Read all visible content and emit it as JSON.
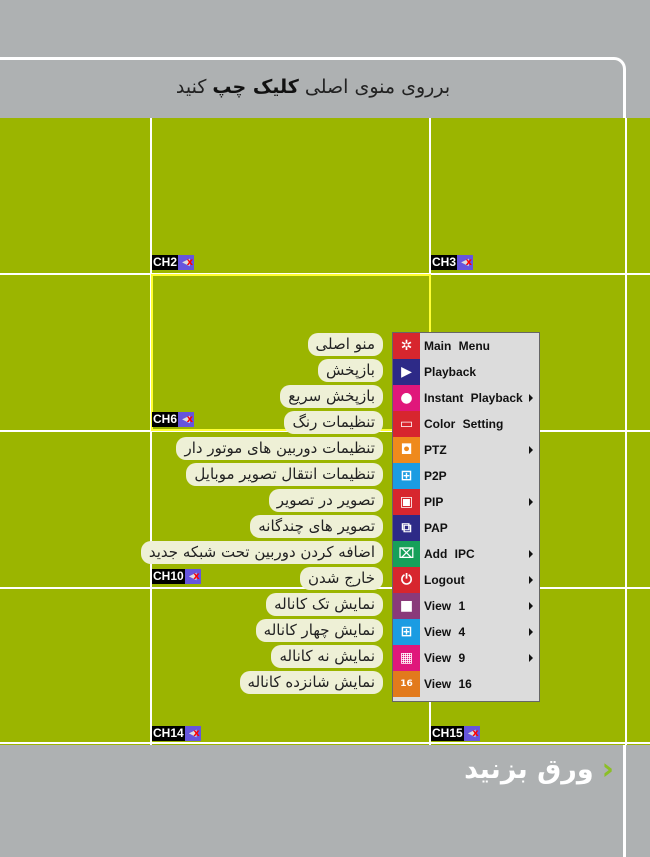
{
  "header": {
    "title_pre": "برروی منوی اصلی",
    "title_bold": "کلیک چپ",
    "title_post": "کنید"
  },
  "channels": [
    {
      "label": "CH2"
    },
    {
      "label": "CH3"
    },
    {
      "label": "CH6"
    },
    {
      "label": "CH10"
    },
    {
      "label": "CH14"
    },
    {
      "label": "CH15"
    }
  ],
  "menu": {
    "items": [
      {
        "label": "Main Menu",
        "icon": "gear-icon",
        "color": "#d7262e",
        "submenu": false
      },
      {
        "label": "Playback",
        "icon": "play-icon",
        "color": "#2d2a87",
        "submenu": false
      },
      {
        "label": "Instant Playback",
        "icon": "person-icon",
        "color": "#e0177b",
        "submenu": true
      },
      {
        "label": "Color Setting",
        "icon": "monitor-icon",
        "color": "#d7262e",
        "submenu": false
      },
      {
        "label": "PTZ",
        "icon": "ptz-camera-icon",
        "color": "#ef8a1c",
        "submenu": true
      },
      {
        "label": "P2P",
        "icon": "network-icon",
        "color": "#1b9ce2",
        "submenu": false
      },
      {
        "label": "PIP",
        "icon": "pip-icon",
        "color": "#d7262e",
        "submenu": true
      },
      {
        "label": "PAP",
        "icon": "pap-icon",
        "color": "#2d2a87",
        "submenu": false
      },
      {
        "label": "Add IPC",
        "icon": "ipc-camera-icon",
        "color": "#16a05a",
        "submenu": true
      },
      {
        "label": "Logout",
        "icon": "power-icon",
        "color": "#d7262e",
        "submenu": true
      },
      {
        "label": "View 1",
        "icon": "view1-icon",
        "color": "#8a3a7a",
        "submenu": true
      },
      {
        "label": "View 4",
        "icon": "view4-icon",
        "color": "#1b9ce2",
        "submenu": true
      },
      {
        "label": "View 9",
        "icon": "view9-icon",
        "color": "#e0177b",
        "submenu": true
      },
      {
        "label": "View 16",
        "icon": "view16-icon",
        "color": "#e27a1c",
        "submenu": false
      }
    ]
  },
  "translations": [
    "منو اصلی",
    "بازپخش",
    "بازپخش سریع",
    "تنظیمات رنگ",
    "تنظیمات دوربین های موتور دار",
    "تنظیمات انتقال تصویر موبایل",
    "تصویر در تصویر",
    "تصویر های چندگانه",
    "اضافه کردن دوربین تحت شبکه جدید",
    "خارج شدن",
    "نمایش تک کاناله",
    "نمایش چهار کاناله",
    "نمایش نه کاناله",
    "نمایش شانزده کاناله"
  ],
  "footer": {
    "next_label": "ورق بزنید"
  },
  "colors": {
    "grid": "#9bb500",
    "selection": "#ffff33",
    "background": "#aeb1b2"
  }
}
